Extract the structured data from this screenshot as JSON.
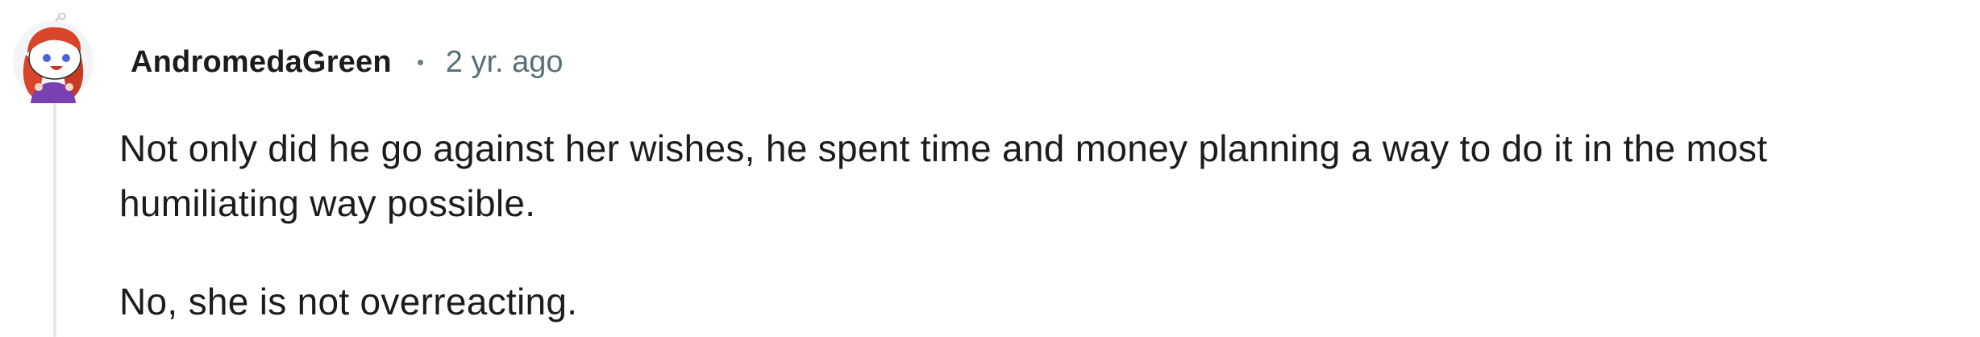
{
  "comment": {
    "author": "AndromedaGreen",
    "timestamp": "2 yr. ago",
    "paragraphs": [
      "Not only did he go against her wishes, he spent time and money planning a way to do it in the most humiliating way possible.",
      "No, she is not overreacting."
    ],
    "avatar_icon": "snoo-avatar-icon"
  },
  "colors": {
    "author_text": "#1c1c1c",
    "meta_text": "#576f76",
    "thread_line": "#e5e7e9",
    "avatar_hair": "#d9452b",
    "avatar_shirt": "#7a3fb0"
  }
}
